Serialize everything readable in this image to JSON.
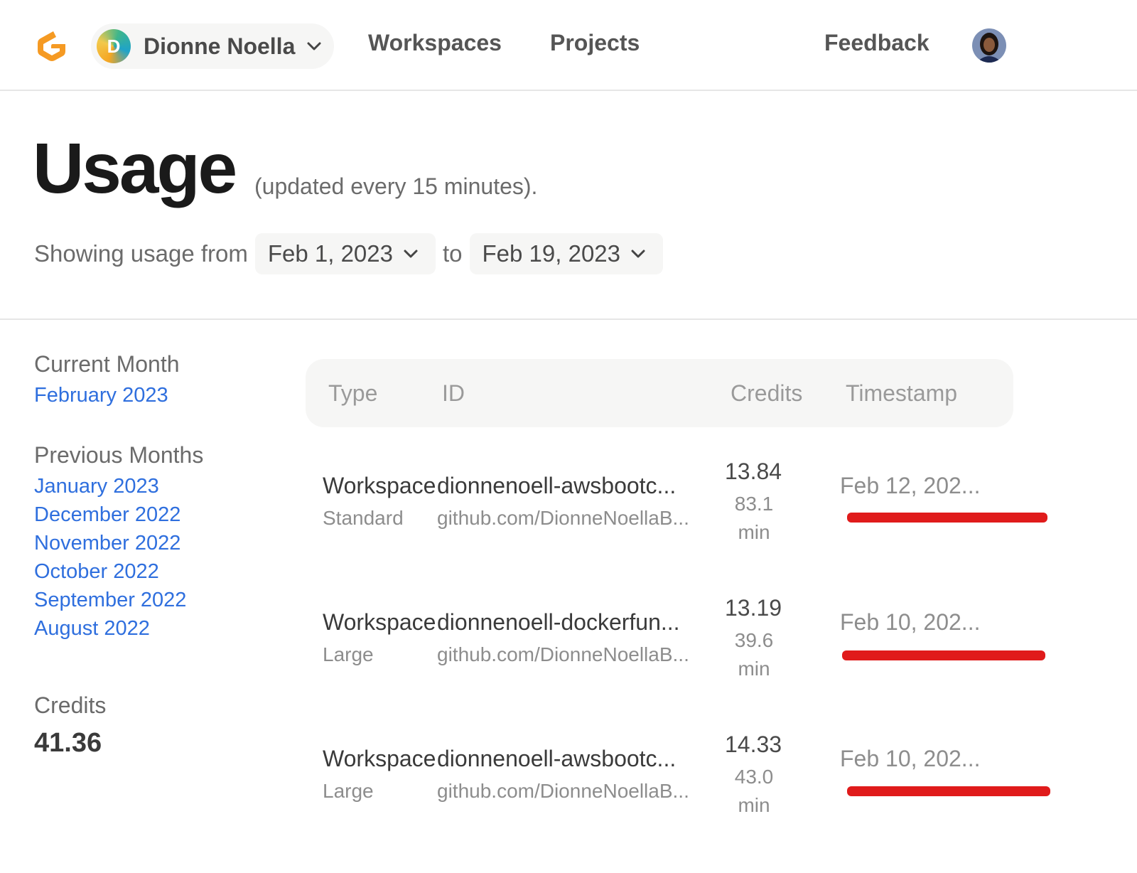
{
  "nav": {
    "account_initial": "D",
    "account_name": "Dionne Noella",
    "links": {
      "workspaces": "Workspaces",
      "projects": "Projects",
      "feedback": "Feedback"
    },
    "icons": {
      "logo": "gitpod-logo",
      "chevron": "chevron-down-icon",
      "user": "user-avatar"
    }
  },
  "header": {
    "title": "Usage",
    "subtitle": "(updated every 15 minutes).",
    "range_label": "Showing usage from",
    "range_from": "Feb 1, 2023",
    "range_to_label": "to",
    "range_to": "Feb 19, 2023"
  },
  "sidebar": {
    "current_heading": "Current Month",
    "current_month": "February 2023",
    "previous_heading": "Previous Months",
    "previous_months": [
      "January 2023",
      "December 2022",
      "November 2022",
      "October 2022",
      "September 2022",
      "August 2022"
    ],
    "credits_heading": "Credits",
    "credits_total": "41.36"
  },
  "table": {
    "headers": {
      "type": "Type",
      "id": "ID",
      "credits": "Credits",
      "timestamp": "Timestamp"
    },
    "rows": [
      {
        "type": "Workspace",
        "class": "Standard",
        "id": "dionnenoell-awsbootc...",
        "repo": "github.com/DionneNoellaB...",
        "credits": "13.84",
        "duration": "83.1",
        "unit": "min",
        "timestamp": "Feb 12, 202..."
      },
      {
        "type": "Workspace",
        "class": "Large",
        "id": "dionnenoell-dockerfun...",
        "repo": "github.com/DionneNoellaB...",
        "credits": "13.19",
        "duration": "39.6",
        "unit": "min",
        "timestamp": "Feb 10, 202..."
      },
      {
        "type": "Workspace",
        "class": "Large",
        "id": "dionnenoell-awsbootc...",
        "repo": "github.com/DionneNoellaB...",
        "credits": "14.33",
        "duration": "43.0",
        "unit": "min",
        "timestamp": "Feb 10, 202..."
      }
    ]
  },
  "colors": {
    "link": "#2f6fde",
    "redaction": "#e01b1b",
    "logo": "#f59a23"
  }
}
